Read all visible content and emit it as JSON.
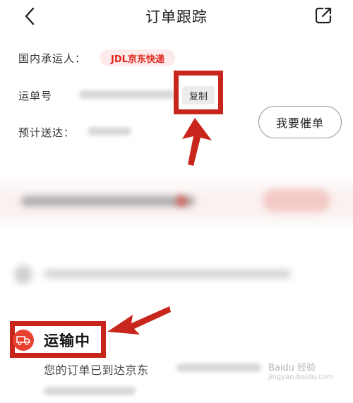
{
  "header": {
    "title": "订单跟踪"
  },
  "info": {
    "carrier_label": "国内承运人：",
    "carrier_name": "JDL京东快递",
    "waybill_label": "运单号",
    "copy_label": "复制",
    "eta_label": "预计送达："
  },
  "urge_button": {
    "label": "我要催单"
  },
  "tracking": {
    "status": "运输中",
    "message": "您的订单已到达京东"
  },
  "watermark": {
    "brand": "Baidu 经验",
    "url": "jingyan.baidu.com"
  },
  "colors": {
    "accent_red": "#e1251b",
    "annotation_red": "#c8261c",
    "status_icon_red": "#e8402f"
  },
  "icons": [
    "back-icon",
    "share-icon",
    "truck-icon",
    "annotation-arrow-icon"
  ]
}
